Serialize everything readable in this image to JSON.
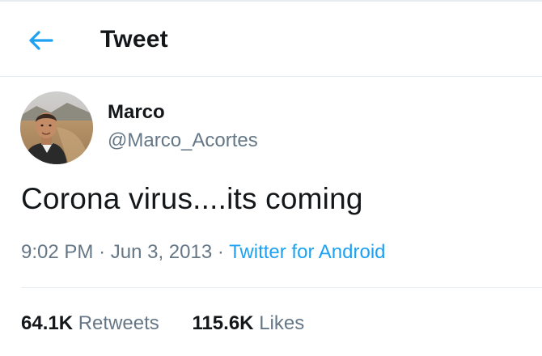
{
  "header": {
    "title": "Tweet",
    "back_icon": "arrow-left-icon"
  },
  "colors": {
    "accent": "#1da1f2",
    "text_primary": "#14171a",
    "text_secondary": "#657786",
    "divider": "#e6ecf0"
  },
  "tweet": {
    "author": {
      "name": "Marco",
      "handle": "@Marco_Acortes"
    },
    "text": "Corona virus....its coming",
    "time": "9:02 PM",
    "separator": "·",
    "date": "Jun 3, 2013",
    "source": "Twitter for Android"
  },
  "stats": {
    "retweets_count": "64.1K",
    "retweets_label": "Retweets",
    "likes_count": "115.6K",
    "likes_label": "Likes"
  }
}
